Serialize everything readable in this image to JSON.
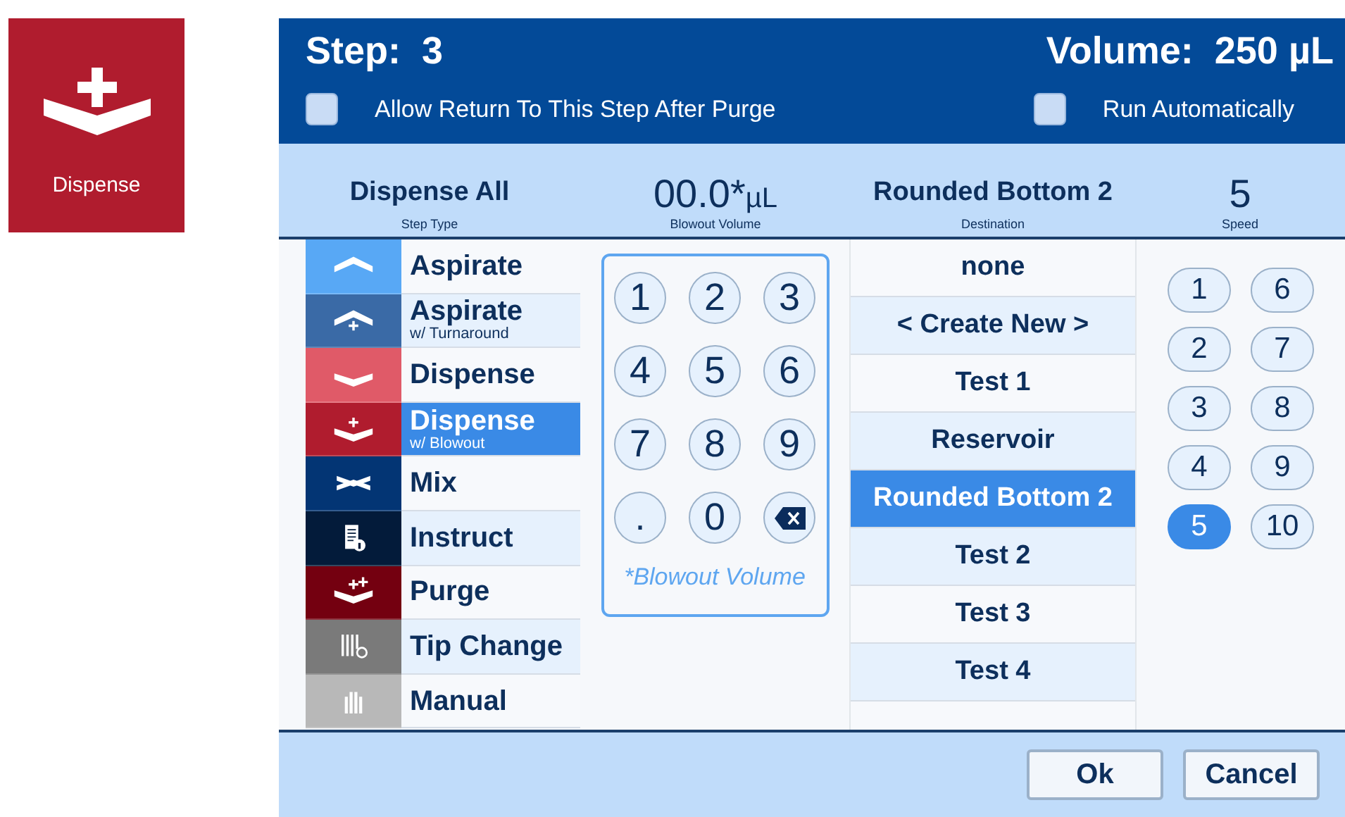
{
  "tile": {
    "label": "Dispense",
    "color": "#b01c2e"
  },
  "header": {
    "step_label": "Step:",
    "step": "3",
    "volume_label": "Volume:",
    "volume": "250 µL",
    "options": [
      {
        "label": "Allow Return To This Step After Purge",
        "checked": false
      },
      {
        "label": "Run Automatically",
        "checked": false
      }
    ]
  },
  "summary": [
    {
      "value": "Dispense All",
      "label": "Step Type"
    },
    {
      "value": "00.0*",
      "unit": "µL",
      "label": "Blowout Volume"
    },
    {
      "value": "Rounded Bottom 2",
      "label": "Destination"
    },
    {
      "value": "5",
      "label": "Speed"
    }
  ],
  "steps": [
    {
      "label": "Aspirate",
      "kind": "up",
      "color": "#58a8f5",
      "selected": false
    },
    {
      "label": "Aspirate",
      "sub": "w/ Turnaround",
      "kind": "up-plus",
      "color": "#3a6aa6",
      "selected": false
    },
    {
      "label": "Dispense",
      "kind": "down",
      "color": "#e05a68",
      "selected": false
    },
    {
      "label": "Dispense",
      "sub": "w/ Blowout",
      "kind": "down-plus",
      "color": "#b01c2e",
      "selected": true
    },
    {
      "label": "Mix",
      "kind": "mix",
      "color": "#033574",
      "selected": false
    },
    {
      "label": "Instruct",
      "kind": "doc",
      "color": "#031b3a",
      "selected": false
    },
    {
      "label": "Purge",
      "kind": "down-plus2",
      "color": "#740010",
      "selected": false
    },
    {
      "label": "Tip Change",
      "kind": "tips",
      "color": "#7a7a7a",
      "selected": false
    },
    {
      "label": "Manual",
      "kind": "hand",
      "color": "#b8b8b8",
      "selected": false
    }
  ],
  "keypad": {
    "keys": [
      {
        "kind": "digit",
        "label": "1"
      },
      {
        "kind": "digit",
        "label": "2"
      },
      {
        "kind": "digit",
        "label": "3"
      },
      {
        "kind": "digit",
        "label": "4"
      },
      {
        "kind": "digit",
        "label": "5"
      },
      {
        "kind": "digit",
        "label": "6"
      },
      {
        "kind": "digit",
        "label": "7"
      },
      {
        "kind": "digit",
        "label": "8"
      },
      {
        "kind": "digit",
        "label": "9"
      },
      {
        "kind": "digit",
        "label": "."
      },
      {
        "kind": "digit",
        "label": "0"
      },
      {
        "kind": "backspace"
      }
    ],
    "caption": "*Blowout Volume"
  },
  "destinations": [
    {
      "label": "none",
      "selected": false
    },
    {
      "label": "< Create New >",
      "selected": false
    },
    {
      "label": "Test 1",
      "selected": false
    },
    {
      "label": "Reservoir",
      "selected": false
    },
    {
      "label": "Rounded Bottom 2",
      "selected": true
    },
    {
      "label": "Test 2",
      "selected": false
    },
    {
      "label": "Test 3",
      "selected": false
    },
    {
      "label": "Test 4",
      "selected": false
    }
  ],
  "speeds": [
    {
      "label": "1",
      "selected": false
    },
    {
      "label": "2",
      "selected": false
    },
    {
      "label": "3",
      "selected": false
    },
    {
      "label": "4",
      "selected": false
    },
    {
      "label": "5",
      "selected": true
    },
    {
      "label": "6",
      "selected": false
    },
    {
      "label": "7",
      "selected": false
    },
    {
      "label": "8",
      "selected": false
    },
    {
      "label": "9",
      "selected": false
    },
    {
      "label": "10",
      "selected": false
    }
  ],
  "buttons": [
    "Ok",
    "Cancel"
  ]
}
